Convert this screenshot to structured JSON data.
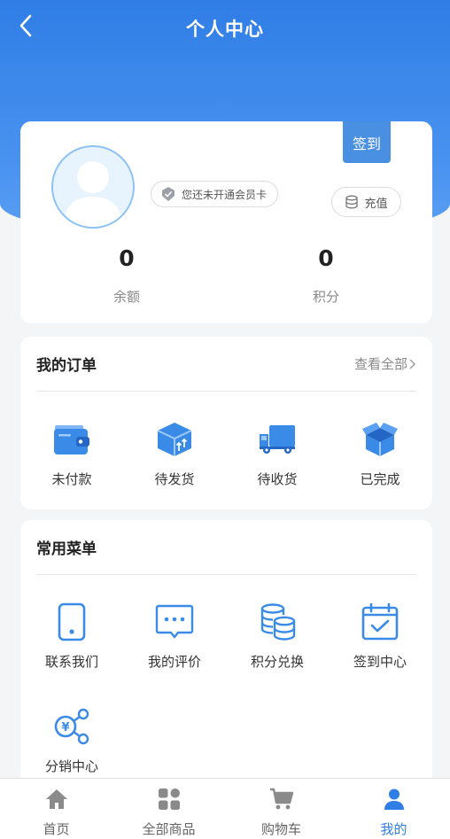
{
  "header": {
    "title": "个人中心",
    "back_icon": "chevron-left-icon"
  },
  "profile": {
    "member_text": "您还未开通会员卡",
    "signin_label": "签到",
    "recharge_label": "充值",
    "stats": [
      {
        "value": "0",
        "label": "余额"
      },
      {
        "value": "0",
        "label": "积分"
      }
    ]
  },
  "orders": {
    "title": "我的订单",
    "view_all": "查看全部",
    "items": [
      {
        "label": "未付款",
        "icon": "wallet-icon"
      },
      {
        "label": "待发货",
        "icon": "package-icon"
      },
      {
        "label": "待收货",
        "icon": "truck-icon"
      },
      {
        "label": "已完成",
        "icon": "open-box-icon"
      }
    ]
  },
  "menu": {
    "title": "常用菜单",
    "items": [
      {
        "label": "联系我们",
        "icon": "phone-icon"
      },
      {
        "label": "我的评价",
        "icon": "comment-icon"
      },
      {
        "label": "积分兑换",
        "icon": "coins-icon"
      },
      {
        "label": "签到中心",
        "icon": "calendar-check-icon"
      },
      {
        "label": "分销中心",
        "icon": "distribution-icon"
      }
    ]
  },
  "tabbar": {
    "active_index": 3,
    "items": [
      {
        "label": "首页",
        "icon": "home-icon"
      },
      {
        "label": "全部商品",
        "icon": "grid-icon"
      },
      {
        "label": "购物车",
        "icon": "cart-icon"
      },
      {
        "label": "我的",
        "icon": "user-icon"
      }
    ]
  },
  "colors": {
    "primary": "#2f7ee6",
    "icon_blue": "#3a8be8",
    "tab_inactive": "#8a8a8a"
  }
}
